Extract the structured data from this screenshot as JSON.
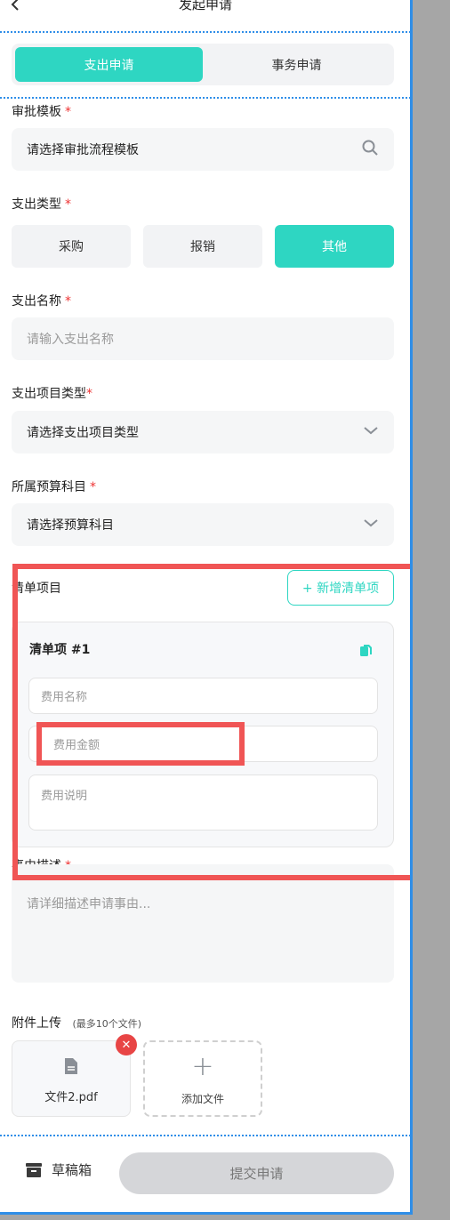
{
  "header": {
    "title": "发起申请",
    "back_icon": "chevron-left-icon"
  },
  "tabs": [
    {
      "label": "支出申请",
      "active": true
    },
    {
      "label": "事务申请",
      "active": false
    }
  ],
  "template": {
    "label": "审批模板",
    "required_mark": "*",
    "value": "请选择审批流程模板",
    "icon": "search-icon"
  },
  "expense_type": {
    "label": "支出类型",
    "required_mark": "*",
    "options": [
      {
        "label": "采购",
        "active": false
      },
      {
        "label": "报销",
        "active": false
      },
      {
        "label": "其他",
        "active": true
      }
    ]
  },
  "expense_name": {
    "label": "支出名称",
    "required_mark": "*",
    "placeholder": "请输入支出名称"
  },
  "project_type": {
    "label": "支出项目类型",
    "required_mark": "*",
    "value": "请选择支出项目类型",
    "icon": "chevron-down-icon"
  },
  "budget": {
    "label": "所属预算科目",
    "required_mark": "*",
    "value": "请选择预算科目",
    "icon": "chevron-down-icon"
  },
  "items": {
    "label": "清单项目",
    "add_button": "+ 新增清单项",
    "card": {
      "title": "清单项 #1",
      "copy_icon": "copy-icon",
      "name_placeholder": "费用名称",
      "amount_placeholder": "费用金额",
      "desc_placeholder": "费用说明"
    }
  },
  "reason": {
    "label": "事由描述",
    "required_mark": "*",
    "placeholder": "请详细描述申请事由..."
  },
  "attachments": {
    "label": "附件上传",
    "hint": "(最多10个文件)",
    "files": [
      {
        "name": "文件2.pdf",
        "icon": "file-icon"
      }
    ],
    "remove_label": "✕",
    "add_label": "添加文件",
    "add_symbol": "+"
  },
  "footer": {
    "draft_label": "草稿箱",
    "draft_icon": "archive-icon",
    "submit_label": "提交申请"
  },
  "colors": {
    "accent": "#2ed6c2",
    "required": "#e33333",
    "highlight": "#f05555",
    "frame": "#2f8ee8"
  }
}
